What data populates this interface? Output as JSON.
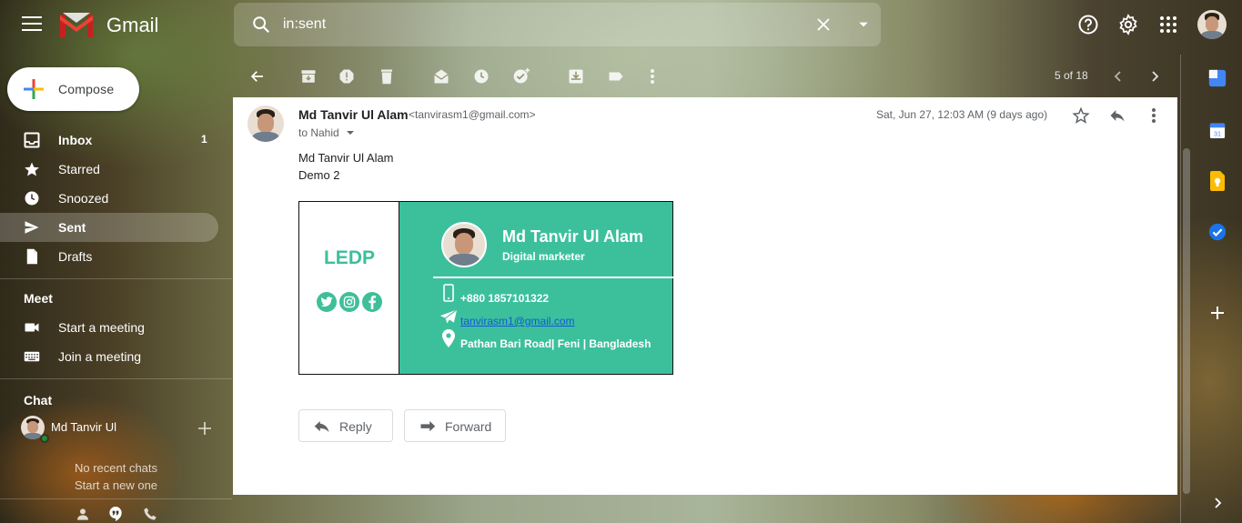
{
  "header": {
    "brand": "Gmail",
    "search_value": "in:sent"
  },
  "sidebar": {
    "compose_label": "Compose",
    "items": [
      {
        "label": "Inbox",
        "count": "1"
      },
      {
        "label": "Starred"
      },
      {
        "label": "Snoozed"
      },
      {
        "label": "Sent"
      },
      {
        "label": "Drafts"
      }
    ],
    "meet": {
      "heading": "Meet",
      "items": [
        {
          "label": "Start a meeting"
        },
        {
          "label": "Join a meeting"
        }
      ]
    },
    "chat": {
      "heading": "Chat",
      "user": "Md Tanvir Ul",
      "empty_line1": "No recent chats",
      "empty_line2": "Start a new one"
    }
  },
  "toolbar": {
    "pager": "5 of 18"
  },
  "email": {
    "sender_name": "Md Tanvir Ul Alam",
    "sender_email": "<tanvirasm1@gmail.com>",
    "to": "to Nahid",
    "date": "Sat, Jun 27, 12:03 AM (9 days ago)",
    "body": [
      "Md Tanvir Ul Alam",
      "Demo 2"
    ],
    "signature": {
      "brand": "LEDP",
      "name": "Md Tanvir Ul Alam",
      "title": "Digital marketer",
      "phone": "+880 1857101322",
      "email": "tanvirasm1@gmail.com",
      "address": "Pathan Bari Road| Feni | Bangladesh",
      "accent_color": "#3cc09c"
    },
    "reply_label": "Reply",
    "forward_label": "Forward"
  }
}
